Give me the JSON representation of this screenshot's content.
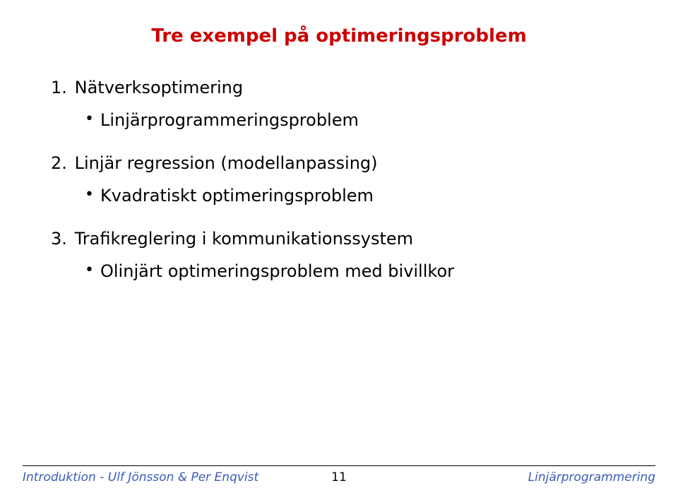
{
  "title": "Tre exempel på optimeringsproblem",
  "items": [
    {
      "num": "1.",
      "text": "Nätverksoptimering",
      "sub": [
        "Linjärprogrammeringsproblem"
      ]
    },
    {
      "num": "2.",
      "text": "Linjär regression (modellanpassing)",
      "sub": [
        "Kvadratiskt optimeringsproblem"
      ]
    },
    {
      "num": "3.",
      "text": "Trafikreglering i kommunikationssystem",
      "sub": [
        "Olinjärt optimeringsproblem med bivillkor"
      ]
    }
  ],
  "footer": {
    "left": "Introduktion - Ulf Jönsson & Per Enqvist",
    "center": "11",
    "right": "Linjärprogrammering"
  }
}
